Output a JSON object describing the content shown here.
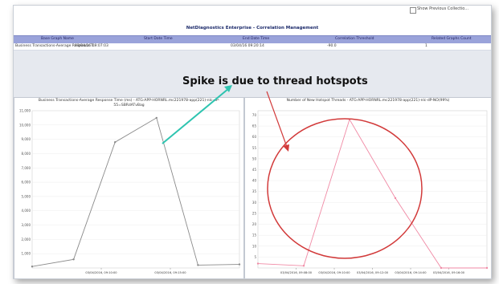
{
  "window": {
    "show_previous_label": "Show Previous Collectio...",
    "title": "NetDiagnostics Enterprise - Correlation Management"
  },
  "table": {
    "headers": [
      "Base Graph Name",
      "Start Date Time",
      "End Date Time",
      "Correlation Threshold",
      "Related Graphs Count"
    ],
    "row": [
      "Business Transactions-Average Response T...",
      "03/04/16 09:07:03",
      "03/04/16 09:20:14",
      "-90.0",
      "1"
    ]
  },
  "annotation": {
    "text": "Spike is due to thread hotspots"
  },
  "colors": {
    "header_bg": "#9aa3da",
    "left_series": "#8a8a8a",
    "right_series": "#f08aa5",
    "circle": "#d23a3a",
    "teal_arrow": "#2ec4b0",
    "red_arrow": "#d23a3a"
  },
  "left_panel": {
    "title_line1": "Business Transactions-Average Response Time (ms) - ATG-APP-HORNRL.mc221978-app(221)-nlc-dP-",
    "title_line2": "55=SBRdATvBag"
  },
  "right_panel": {
    "title": "Number of New Hotspot Threads - ATG-APP-HORNRL.mc221978-app(221)-nlc-dP-NO(99%)"
  },
  "chart_data": [
    {
      "type": "line",
      "ylim": [
        0,
        11000
      ],
      "yticks": [
        "11,000",
        "10,000",
        "9,000",
        "8,000",
        "7,000",
        "6,000",
        "5,000",
        "4,000",
        "3,000",
        "2,000",
        "1,000"
      ],
      "xticks": [
        "03/04/2016, 09:10:00",
        "03/04/2016, 09:15:00"
      ],
      "x": [
        0,
        1,
        2,
        3,
        4,
        5
      ],
      "values": [
        100,
        600,
        8800,
        10500,
        200,
        250
      ]
    },
    {
      "type": "line",
      "ylim": [
        0,
        72
      ],
      "yticks": [
        "70",
        "65",
        "60",
        "55",
        "50",
        "45",
        "40",
        "35",
        "30",
        "25",
        "20",
        "15",
        "10",
        "5"
      ],
      "xticks": [
        "03/04/2016, 09:08:00",
        "03/04/2016, 09:10:00",
        "03/04/2016, 09:12:00",
        "03/04/2016, 09:14:00",
        "03/04/2016, 09:16:00"
      ],
      "x": [
        0,
        1,
        2,
        3,
        4,
        5
      ],
      "values": [
        2,
        1,
        68,
        32,
        0,
        0
      ]
    }
  ]
}
